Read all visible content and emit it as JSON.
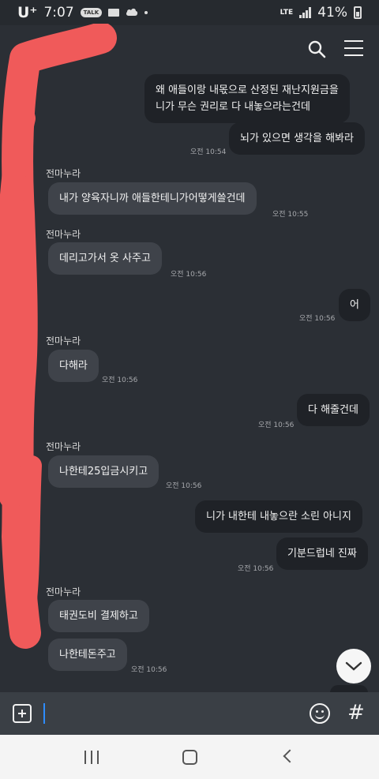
{
  "status_bar": {
    "carrier": "U⁺",
    "time": "7:07",
    "talk_badge": "TALK",
    "network": "LTE",
    "battery": "41%",
    "notification_icons": [
      "talk-badge-icon",
      "mail-icon",
      "cloud-icon",
      "dot-icon"
    ]
  },
  "header": {
    "icons": [
      "search-icon",
      "menu-icon"
    ]
  },
  "messages": [
    {
      "side": "out",
      "text": [
        "왜 애들이랑 내몫으로 산정된 재난지원금을",
        "니가 무슨 권리로 다 내놓으라는건데"
      ]
    },
    {
      "side": "out",
      "text": [
        "뇌가 있으면 생각을 해봐라"
      ],
      "time": "오전 10:54"
    },
    {
      "side": "in",
      "sender": "전마누라",
      "text": [
        "내가 양육자니까 애들한테니가어떻게쓸건데"
      ],
      "time": "오전 10:55"
    },
    {
      "side": "in",
      "sender": "전마누라",
      "text": [
        "데리고가서 옷 사주고"
      ],
      "time": "오전 10:56"
    },
    {
      "side": "out",
      "text": [
        "어"
      ],
      "time": "오전 10:56"
    },
    {
      "side": "in",
      "sender": "전마누라",
      "text": [
        "다해라"
      ],
      "time": "오전 10:56"
    },
    {
      "side": "out",
      "text": [
        "다 해줄건데"
      ],
      "time": "오전 10:56"
    },
    {
      "side": "in",
      "sender": "전마누라",
      "text": [
        "나한테25입금시키고"
      ],
      "time": "오전 10:56"
    },
    {
      "side": "out",
      "text": [
        "니가 내한테 내놓으란 소린 아니지"
      ]
    },
    {
      "side": "out",
      "text": [
        "기분드럽네 진짜"
      ],
      "time": "오전 10:56"
    },
    {
      "side": "in",
      "sender": "전마누라",
      "text": [
        "태권도비 결제하고"
      ]
    },
    {
      "side": "in",
      "text": [
        "나한테돈주고"
      ],
      "time": "오전 10:56"
    }
  ],
  "input_bar": {
    "placeholder": "",
    "icons": [
      "plus-icon",
      "emoji-icon",
      "hash-icon"
    ],
    "hash_symbol": "#"
  },
  "nav_bar": {
    "icons": [
      "recent-apps-icon",
      "home-icon",
      "back-icon"
    ]
  },
  "colors": {
    "background": "#2b2f35",
    "outgoing_bubble": "#1f2227",
    "incoming_bubble": "#3f434a",
    "scribble": "#f05a5a",
    "caret": "#2d8cff"
  }
}
